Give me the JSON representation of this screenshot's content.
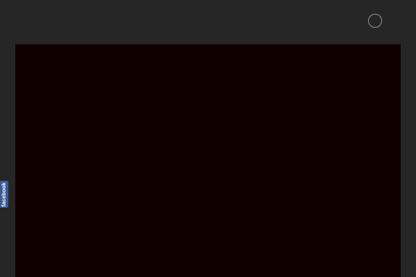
{
  "header": {
    "icon": "loading-spinner-icon"
  },
  "social_tab": {
    "label": "facebook",
    "color": "#3b5998"
  },
  "colors": {
    "page_background": "#262626",
    "content_background": "#110000"
  }
}
